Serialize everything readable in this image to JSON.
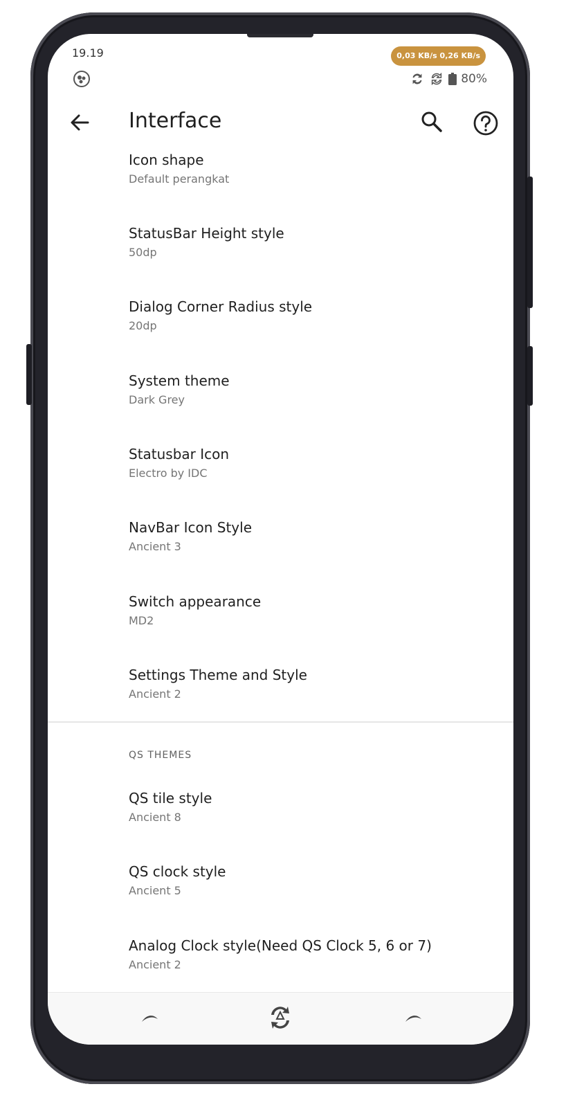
{
  "status_bar": {
    "time": "19.19",
    "net_speed": "0,03 KB/s 0,26 KB/s",
    "battery": "80%",
    "left_icon": "app-notification-icon",
    "right_icons": [
      "sync-icon",
      "sync-icon",
      "battery-icon"
    ]
  },
  "app_bar": {
    "title": "Interface",
    "back_icon": "arrow-back-icon",
    "search_icon": "search-icon",
    "help_icon": "help-circle-icon"
  },
  "settings": [
    {
      "title": "Icon shape",
      "value": "Default perangkat"
    },
    {
      "title": "StatusBar Height style",
      "value": "50dp"
    },
    {
      "title": "Dialog Corner Radius style",
      "value": "20dp"
    },
    {
      "title": "System theme",
      "value": "Dark Grey"
    },
    {
      "title": "Statusbar Icon",
      "value": "Electro by IDC"
    },
    {
      "title": "NavBar Icon Style",
      "value": "Ancient 3"
    },
    {
      "title": "Switch appearance",
      "value": "MD2"
    },
    {
      "title": "Settings Theme and Style",
      "value": "Ancient 2"
    }
  ],
  "qs_section": {
    "header": "QS THEMES",
    "items": [
      {
        "title": "QS tile style",
        "value": "Ancient 8"
      },
      {
        "title": "QS clock style",
        "value": "Ancient 5"
      },
      {
        "title": "Analog Clock style(Need QS Clock 5, 6 or 7)",
        "value": "Ancient 2"
      }
    ]
  },
  "nav_bar": {
    "back_icon": "nav-back-icon",
    "home_icon": "nav-home-icon",
    "recents_icon": "nav-recents-icon"
  },
  "colors": {
    "speed_pill": "#c9933f",
    "text_primary": "#1f1f1f",
    "text_secondary": "#757575",
    "frame": "#23232a"
  }
}
